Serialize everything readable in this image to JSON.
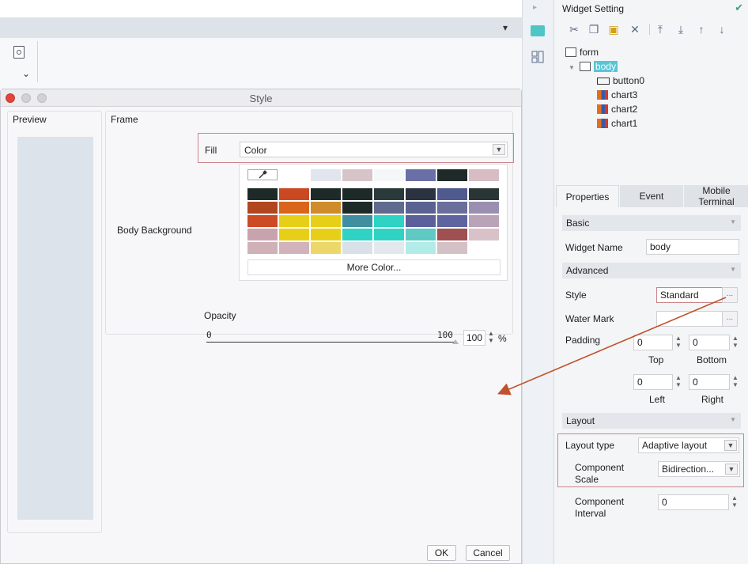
{
  "background_app": {
    "toolbar_preview_icon": "document-search-icon",
    "dropdown_chevron": "⌄"
  },
  "dialog": {
    "title": "Style",
    "preview_label": "Preview",
    "frame_label": "Frame",
    "fill_label": "Fill",
    "fill_value": "Color",
    "body_background_label": "Body Background",
    "more_color_label": "More Color...",
    "opacity_label": "Opacity",
    "opacity_min": "0",
    "opacity_max": "100",
    "opacity_value": "100",
    "opacity_unit": "%",
    "ok_label": "OK",
    "cancel_label": "Cancel",
    "palette_top_row": [
      "#ffffff",
      "#ffffff",
      "#e1e6ee",
      "#d7c4c9",
      "#f5f6f8",
      "#6b6fa7",
      "#1f2a28",
      "#d8bcc3"
    ],
    "palette_rows": [
      [
        "#1e2a28",
        "#c94a22",
        "#1e2a28",
        "#1e2a28",
        "#2a3a3a",
        "#2b3340",
        "#4f5a8f",
        "#2a3536"
      ],
      [
        "#b1461f",
        "#d9651b",
        "#d08c2a",
        "#1e2a28",
        "#5f6a8d",
        "#5a6291",
        "#6a6e9b",
        "#9a8fb0"
      ],
      [
        "#cc4a24",
        "#e7cf18",
        "#e7cf18",
        "#3f8fa0",
        "#2ed3c3",
        "#5b5f9a",
        "#5d64a0",
        "#b9a3b8"
      ],
      [
        "#c8a3ad",
        "#e7cf18",
        "#e7cf18",
        "#2ed3c3",
        "#2ed3c3",
        "#5fc9c3",
        "#9f5050",
        "#d8c2c8"
      ],
      [
        "#d0b1b7",
        "#d3b3bb",
        "#ecd86a",
        "#d9e1e8",
        "#e3e8ed",
        "#b2ece8",
        "#d4c1c6",
        "#ffffff"
      ]
    ]
  },
  "widget_setting": {
    "title": "Widget Setting",
    "toolbar_icons": [
      "cut-icon",
      "copy-icon",
      "paste-icon",
      "delete-icon",
      "move-top-icon",
      "move-bottom-icon",
      "move-up-icon",
      "move-down-icon"
    ],
    "tree": {
      "root": "form",
      "body": "body",
      "children": [
        "button0",
        "chart3",
        "chart2",
        "chart1"
      ]
    },
    "tabs": {
      "properties": "Properties",
      "event": "Event",
      "mobile": "Mobile Terminal"
    },
    "basic_header": "Basic",
    "widget_name_label": "Widget Name",
    "widget_name_value": "body",
    "advanced_header": "Advanced",
    "style_label": "Style",
    "style_value": "Standard",
    "water_mark_label": "Water Mark",
    "water_mark_value": "",
    "padding_label": "Padding",
    "padding_top": "0",
    "padding_bottom": "0",
    "padding_left": "0",
    "padding_right": "0",
    "top_label": "Top",
    "bottom_label": "Bottom",
    "left_label": "Left",
    "right_label": "Right",
    "layout_header": "Layout",
    "layout_type_label": "Layout type",
    "layout_type_value": "Adaptive layout",
    "component_scale_label": "Component Scale",
    "component_scale_value": "Bidirection...",
    "component_interval_label": "Component Interval",
    "component_interval_value": "0",
    "ellipsis": "..."
  },
  "colors": {
    "highlight_border": "#c9868a",
    "annotation_arrow": "#c0522e",
    "accent_teal": "#3aa27a",
    "selected_node_bg": "#56c6d6"
  }
}
